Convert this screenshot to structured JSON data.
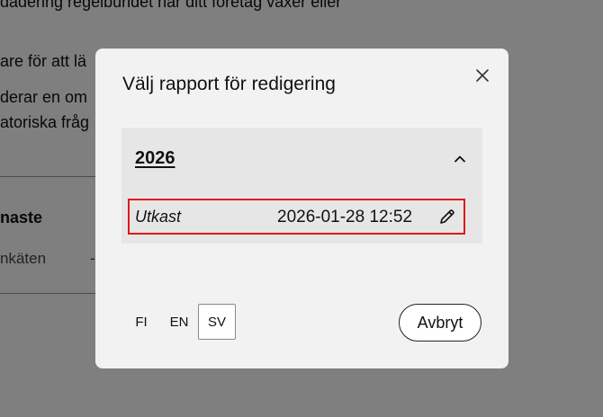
{
  "background": {
    "lines": [
      "dadering regelbundet när ditt företag växer eller",
      "are för att lä",
      "derar en om",
      "atoriska fråg"
    ],
    "heading": "naste",
    "sub": "nkäten",
    "dash": "-"
  },
  "modal": {
    "title": "Välj rapport för redigering",
    "close_icon": "close-icon",
    "year_group": {
      "year": "2026",
      "expanded": true,
      "chevron_icon": "chevron-up-icon",
      "reports": [
        {
          "status": "Utkast",
          "datetime": "2026-01-28 12:52",
          "edit_icon": "pencil-icon",
          "highlight_color": "#e01818"
        }
      ]
    },
    "languages": [
      {
        "code": "FI",
        "active": false
      },
      {
        "code": "EN",
        "active": false
      },
      {
        "code": "SV",
        "active": true
      }
    ],
    "cancel_label": "Avbryt"
  },
  "colors": {
    "overlay": "rgba(0,0,0,0.5)",
    "modal_bg": "#f2f2f2",
    "panel_bg": "#e6e6e6",
    "highlight": "#e01818"
  }
}
